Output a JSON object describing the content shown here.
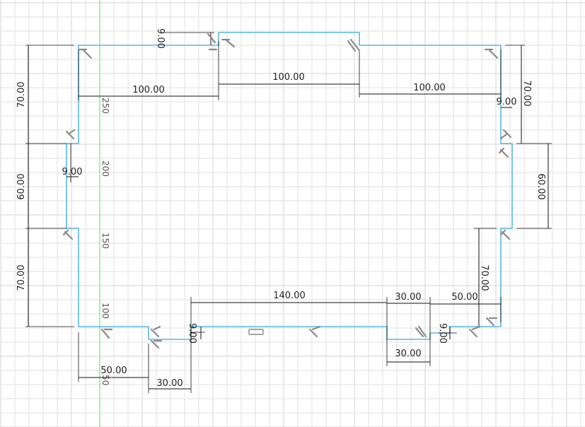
{
  "sketch": {
    "grid_color": "#e2e2e2",
    "grid_major_color": "#d4d4d4",
    "axis_color": "#7ede7e",
    "profile_color": "#5ab8e0",
    "dimension_color": "#111111",
    "constraint_icon_color": "#8a8a8a"
  },
  "ruler_labels": {
    "r250": "250",
    "r200": "200",
    "r150": "150",
    "r100": "100",
    "r50": "50"
  },
  "dimensions": {
    "top_notch_depth": "9.00",
    "top_left_width": "100.00",
    "top_mid_width": "100.00",
    "top_right_width": "100.00",
    "left_upper_height": "70.00",
    "left_mid_height": "60.00",
    "left_lower_height": "70.00",
    "left_notch_depth": "9.00",
    "right_upper_height": "70.00",
    "right_mid_height": "60.00",
    "right_lower_height": "70.00",
    "right_notch_depth": "9.00",
    "bottom_span": "140.00",
    "bottom_slot_a_offset": "30.00",
    "bottom_right_width": "50.00",
    "bottom_left_width": "50.00",
    "bottom_slot_b_width": "30.00",
    "bottom_slot_a_width": "30.00",
    "bottom_slot_b_depth": "9.00",
    "bottom_slot_a_depth": "9.00"
  }
}
